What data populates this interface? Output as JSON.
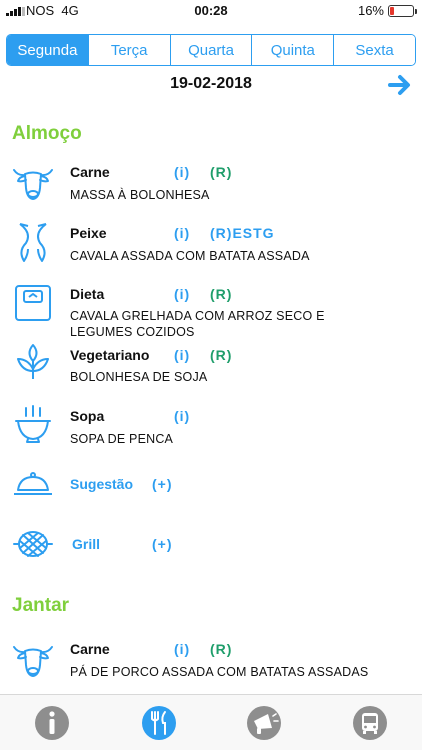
{
  "status_bar": {
    "carrier": "NOS",
    "network": "4G",
    "time": "00:28",
    "battery": "16%",
    "battery_level": 0.16
  },
  "tabs": [
    {
      "label": "Segunda",
      "active": true
    },
    {
      "label": "Terça",
      "active": false
    },
    {
      "label": "Quarta",
      "active": false
    },
    {
      "label": "Quinta",
      "active": false
    },
    {
      "label": "Sexta",
      "active": false
    }
  ],
  "date": "19-02-2018",
  "colors": {
    "accent": "#2d9ef0",
    "section": "#7fcf3c",
    "rating": "#1f9e6b"
  },
  "almoco": {
    "title": "Almoço",
    "carne": {
      "name": "Carne",
      "info": "(i)",
      "rating": "(R)",
      "desc": "MASSA À BOLONHESA",
      "icon": "cow-icon"
    },
    "peixe": {
      "name": "Peixe",
      "info": "(i)",
      "rating": "(R)",
      "extra": "ESTG",
      "desc": "CAVALA ASSADA COM BATATA ASSADA",
      "icon": "fish-icon"
    },
    "dieta": {
      "name": "Dieta",
      "info": "(i)",
      "rating": "(R)",
      "desc": "CAVALA GRELHADA COM ARROZ SECO E LEGUMES COZIDOS",
      "icon": "scale-icon"
    },
    "vegetariano": {
      "name": "Vegetariano",
      "info": "(i)",
      "rating": "(R)",
      "desc": "BOLONHESA DE SOJA",
      "icon": "leaf-icon"
    },
    "sopa": {
      "name": "Sopa",
      "info": "(i)",
      "desc": "SOPA DE PENCA",
      "icon": "soup-bowl-icon"
    },
    "sugestao": {
      "name": "Sugestão",
      "plus": "(+)",
      "icon": "cloche-icon"
    },
    "grill": {
      "name": "Grill",
      "plus": "(+)",
      "icon": "grill-icon"
    }
  },
  "jantar": {
    "title": "Jantar",
    "carne": {
      "name": "Carne",
      "info": "(i)",
      "rating": "(R)",
      "desc": "PÁ DE PORCO ASSADA COM BATATAS ASSADAS",
      "icon": "cow-icon"
    }
  },
  "bottom_nav": [
    {
      "icon": "info-icon",
      "active": false
    },
    {
      "icon": "fork-knife-icon",
      "active": true
    },
    {
      "icon": "megaphone-icon",
      "active": false
    },
    {
      "icon": "bus-icon",
      "active": false
    }
  ]
}
